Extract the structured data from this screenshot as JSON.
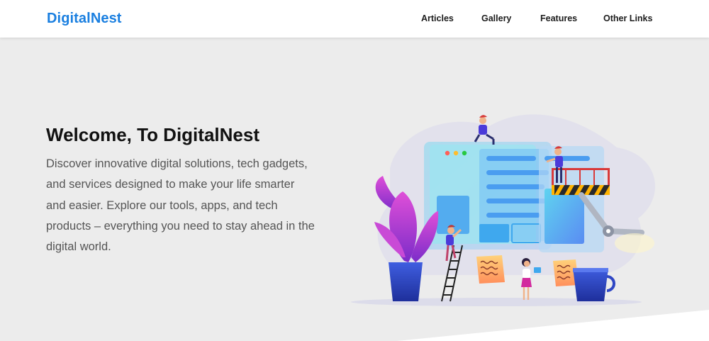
{
  "brand": {
    "name": "DigitalNest"
  },
  "nav": {
    "items": [
      {
        "label": "Articles"
      },
      {
        "label": "Gallery"
      },
      {
        "label": "Features"
      },
      {
        "label": "Other Links"
      }
    ]
  },
  "hero": {
    "title": "Welcome, To DigitalNest",
    "description": "Discover innovative digital solutions, tech gadgets, and services designed to make your life smarter and easier. Explore our tools, apps, and tech products – everything you need to stay ahead in the digital world."
  },
  "colors": {
    "brand": "#1a7fe0",
    "hero_background": "#ececec",
    "navbar_background": "#ffffff"
  },
  "illustration": {
    "icon": "web-development-illustration"
  }
}
